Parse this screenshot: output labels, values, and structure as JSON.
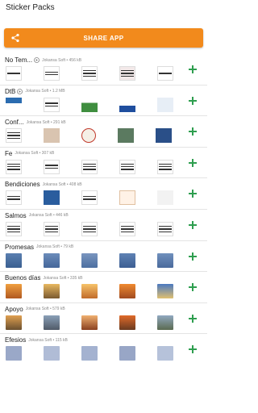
{
  "appbar": {
    "title": "Sticker Packs"
  },
  "share_button": {
    "label": "SHARE APP",
    "icon": "share-icon",
    "color": "#f28a1c"
  },
  "accent_add": "#2e9e4f",
  "packs": [
    {
      "name": "No Tem...",
      "has_play": true,
      "meta": "Jokansa Soft • 456 kB"
    },
    {
      "name": "DtB",
      "has_play": true,
      "meta": "Jokansa Soft • 1.2 MB"
    },
    {
      "name": "Conf...",
      "has_play": false,
      "meta": "Jokansa Soft • 291 kB"
    },
    {
      "name": "Fe",
      "has_play": false,
      "meta": "Jokansa Soft • 307 kB"
    },
    {
      "name": "Bendiciones",
      "has_play": false,
      "meta": "Jokansa Soft • 408 kB"
    },
    {
      "name": "Salmos",
      "has_play": false,
      "meta": "Jokansa Soft • 446 kB"
    },
    {
      "name": "Promesas",
      "has_play": false,
      "meta": "Jokansa Soft • 79 kB"
    },
    {
      "name": "Buenos días",
      "has_play": false,
      "meta": "Jokansa Soft • 335 kB"
    },
    {
      "name": "Apoyo",
      "has_play": false,
      "meta": "Jokansa Soft • 579 kB"
    },
    {
      "name": "Efesios",
      "has_play": false,
      "meta": "Jokansa Soft • 115 kB"
    }
  ]
}
